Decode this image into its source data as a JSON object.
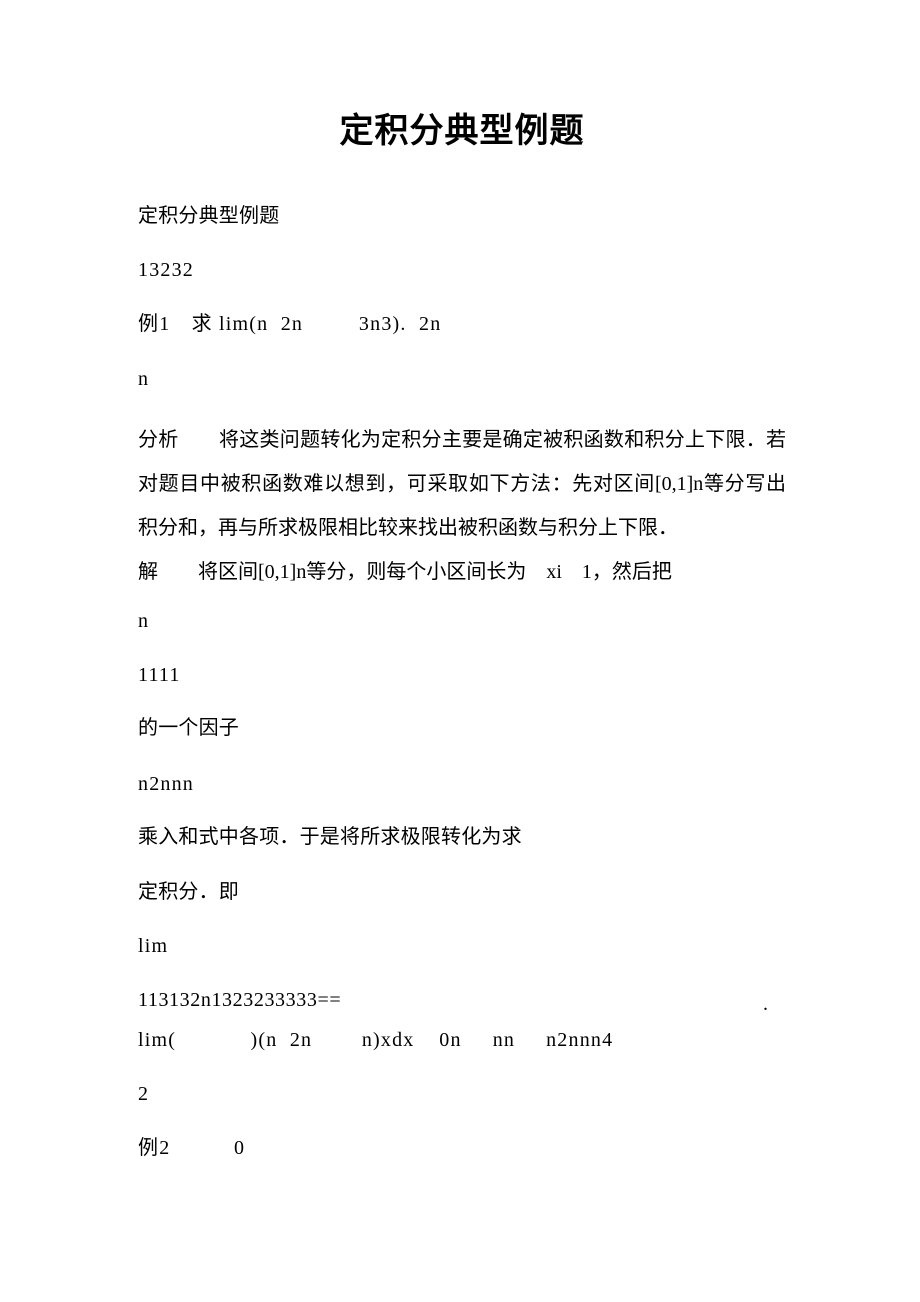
{
  "document": {
    "title": "定积分典型例题",
    "background_color": "#ffffff",
    "text_color": "#000000"
  },
  "body": {
    "heading_repeat": "定积分典型例题",
    "page_number_line": "13232",
    "example1": {
      "label": "例1",
      "verb": "求",
      "expression": "lim(n  2n          3n3)．  2n",
      "full_line": "例1　求 lim(n  2n         3n3).  2n",
      "subscript_line": "n"
    },
    "analysis": {
      "label": "分析",
      "text": "分析　　将这类问题转化为定积分主要是确定被积函数和积分上下限．若对题目中被积函数难以想到，可采取如下方法：先对区间[0,1]n等分写出积分和，再与所求极限相比较来找出被积函数与积分上下限．"
    },
    "solution": {
      "label": "解",
      "line1": "解　　将区间[0,1]n等分，则每个小区间长为　xi　1，然后把",
      "line2": "n",
      "line3": "1111",
      "line4": "的一个因子",
      "line5": "n2nnn",
      "line6": "乘入和式中各项．于是将所求极限转化为求",
      "line7": "定积分．即",
      "line8": "lim",
      "line9": "113132n1323233333==",
      "line9_trailing_dot": ".",
      "line10": "lim(            )(n  2n        n)xdx    0n     nn     n2nnn4",
      "line11": "2"
    },
    "example2": {
      "label": "例2",
      "value": "0",
      "full_line": "例2　　　0"
    }
  }
}
